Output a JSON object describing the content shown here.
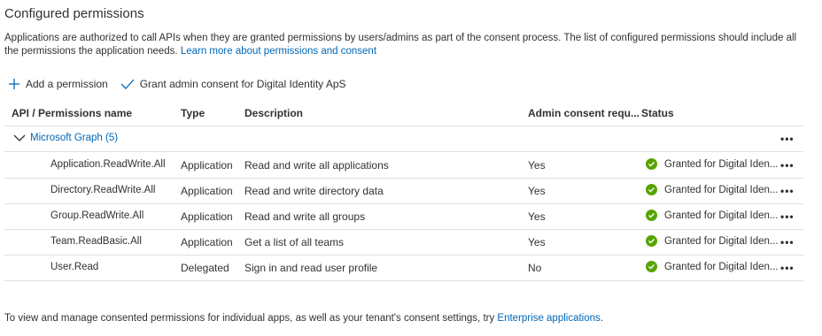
{
  "title": "Configured permissions",
  "description": {
    "text": "Applications are authorized to call APIs when they are granted permissions by users/admins as part of the consent process. The list of configured permissions should include all the permissions the application needs. ",
    "link": "Learn more about permissions and consent"
  },
  "toolbar": {
    "add_label": "Add a permission",
    "grant_label": "Grant admin consent for Digital Identity ApS"
  },
  "table": {
    "headers": {
      "name": "API / Permissions name",
      "type": "Type",
      "description": "Description",
      "admin": "Admin consent requ...",
      "status": "Status"
    },
    "group": "Microsoft Graph (5)",
    "more_glyph": "•••",
    "rows": [
      {
        "name": "Application.ReadWrite.All",
        "type": "Application",
        "description": "Read and write all applications",
        "admin": "Yes",
        "status": "Granted for Digital Iden..."
      },
      {
        "name": "Directory.ReadWrite.All",
        "type": "Application",
        "description": "Read and write directory data",
        "admin": "Yes",
        "status": "Granted for Digital Iden..."
      },
      {
        "name": "Group.ReadWrite.All",
        "type": "Application",
        "description": "Read and write all groups",
        "admin": "Yes",
        "status": "Granted for Digital Iden..."
      },
      {
        "name": "Team.ReadBasic.All",
        "type": "Application",
        "description": "Get a list of all teams",
        "admin": "Yes",
        "status": "Granted for Digital Iden..."
      },
      {
        "name": "User.Read",
        "type": "Delegated",
        "description": "Sign in and read user profile",
        "admin": "No",
        "status": "Granted for Digital Iden..."
      }
    ]
  },
  "footer": {
    "text": "To view and manage consented permissions for individual apps, as well as your tenant's consent settings, try ",
    "link": "Enterprise applications",
    "end": "."
  },
  "colors": {
    "link": "#0067b8",
    "granted": "#57a300",
    "text": "#323130"
  },
  "icons": {
    "add": "plus-icon",
    "grant": "checkmark-icon",
    "expand": "chevron-down-icon",
    "status": "check-circle-icon",
    "more": "more-icon"
  }
}
